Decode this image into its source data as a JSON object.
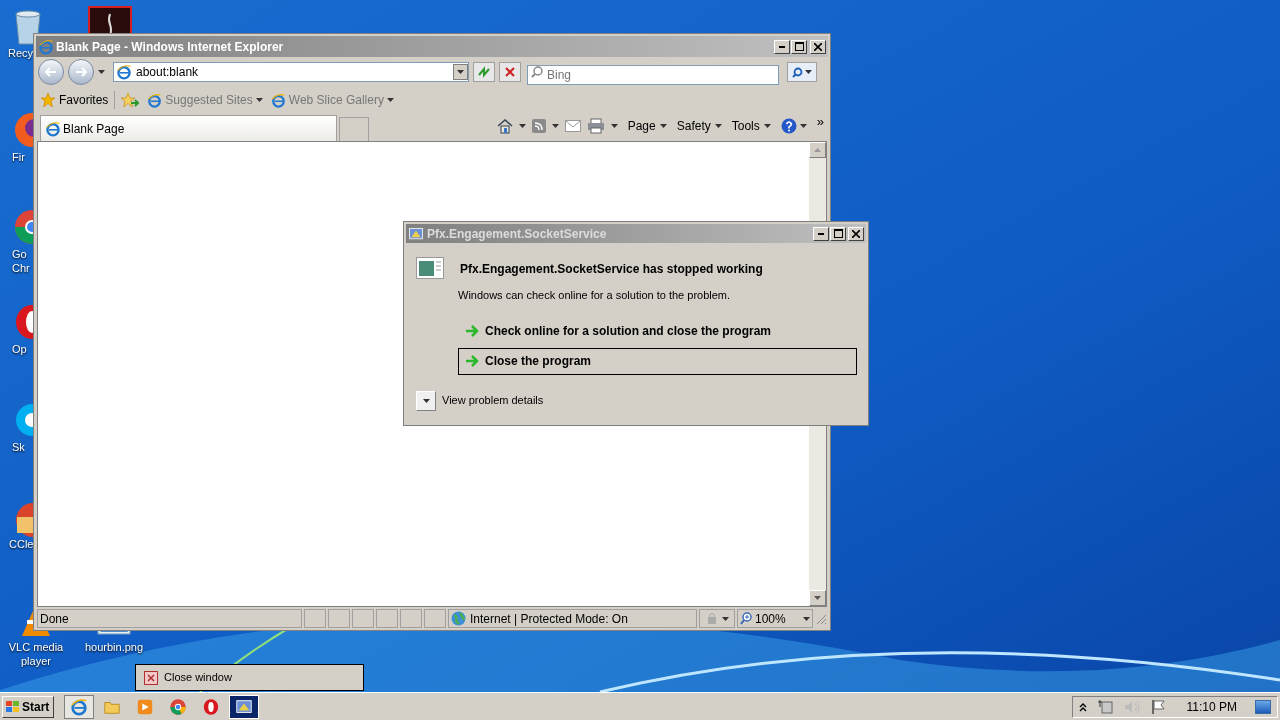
{
  "desktop": {
    "icons": [
      {
        "kind": "recycle",
        "lines": [
          "Recy"
        ]
      },
      {
        "kind": "pdf"
      },
      {
        "kind": "firefox",
        "lines": [
          "Fir"
        ]
      },
      {
        "kind": "chrome",
        "lines": [
          "Go",
          "Chr"
        ]
      },
      {
        "kind": "opera",
        "lines": [
          "Op"
        ]
      },
      {
        "kind": "skype",
        "lines": [
          "Sk"
        ]
      },
      {
        "kind": "ccleaner",
        "lines": [
          "CCle"
        ]
      },
      {
        "kind": "vlc",
        "lines": [
          "VLC media",
          "player"
        ]
      },
      {
        "kind": "image",
        "lines": [
          "hourbin.png"
        ]
      }
    ]
  },
  "browser": {
    "title": "Blank Page - Windows Internet Explorer",
    "address": "about:blank",
    "search": {
      "placeholder": "Bing"
    },
    "favorites": [
      {
        "kind": "favorites",
        "label": "Favorites"
      },
      {
        "kind": "add"
      },
      {
        "kind": "site",
        "label": "Suggested Sites"
      },
      {
        "kind": "site",
        "label": "Web Slice Gallery"
      }
    ],
    "tab": "Blank Page",
    "commands": [
      "Page",
      "Safety",
      "Tools"
    ],
    "more": "»",
    "status": {
      "text": "Done",
      "zone": "Internet | Protected Mode: On",
      "zoom": "100%"
    }
  },
  "dialog": {
    "title": "Pfx.Engagement.SocketService",
    "heading": "Pfx.Engagement.SocketService has stopped working",
    "message": "Windows can check online for a solution to the problem.",
    "options": [
      {
        "label": "Check online for a solution and close the program",
        "selected": false
      },
      {
        "label": "Close the program",
        "selected": true
      }
    ],
    "details": "View problem details"
  },
  "tooltip": "Close window",
  "taskbar": {
    "start": "Start",
    "items": [
      {
        "kind": "ie",
        "selected": false
      },
      {
        "kind": "folder",
        "selected": false
      },
      {
        "kind": "media",
        "selected": false
      },
      {
        "kind": "chrome",
        "selected": false
      },
      {
        "kind": "opera",
        "selected": false
      },
      {
        "kind": "app",
        "selected": true
      }
    ],
    "clock": "11:10 PM"
  }
}
